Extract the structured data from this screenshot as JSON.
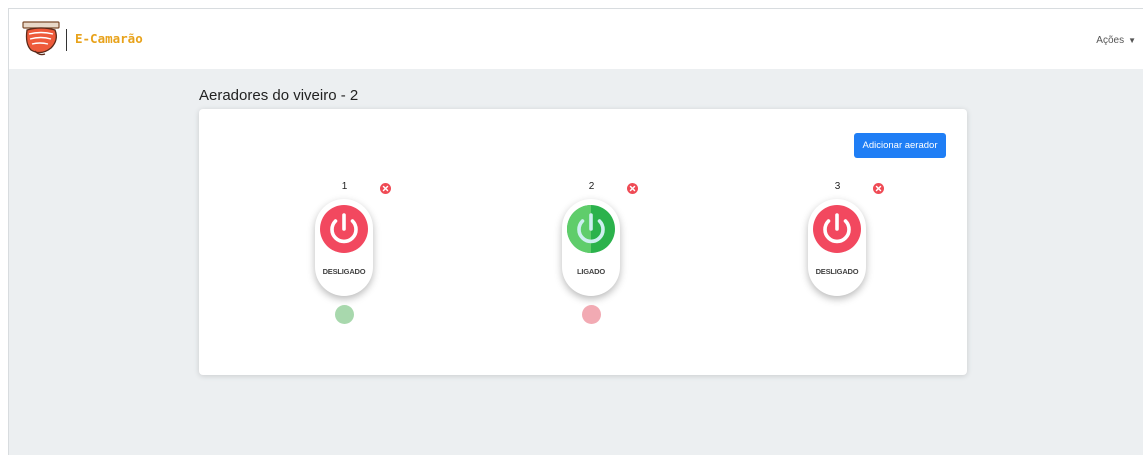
{
  "app": {
    "brand": "E-Camarão",
    "logo_icon": "shrimp-logo"
  },
  "navbar": {
    "actions_label": "Ações"
  },
  "page": {
    "title": "Aeradores do viveiro - 2"
  },
  "toolbar": {
    "add_label": "Adicionar aerador"
  },
  "aerators": [
    {
      "number": "1",
      "state": "DESLIGADO",
      "button_color": "#f2485f",
      "indicator": "green"
    },
    {
      "number": "2",
      "state": "LIGADO",
      "button_color": "#2bb24c",
      "indicator": "red"
    },
    {
      "number": "3",
      "state": "DESLIGADO",
      "button_color": "#f2485f",
      "indicator": "none"
    }
  ],
  "colors": {
    "accent": "#1f7ef5",
    "brand": "#e8a21a",
    "on": "#2bb24c",
    "off": "#f2485f",
    "remove": "#ef4b55"
  }
}
